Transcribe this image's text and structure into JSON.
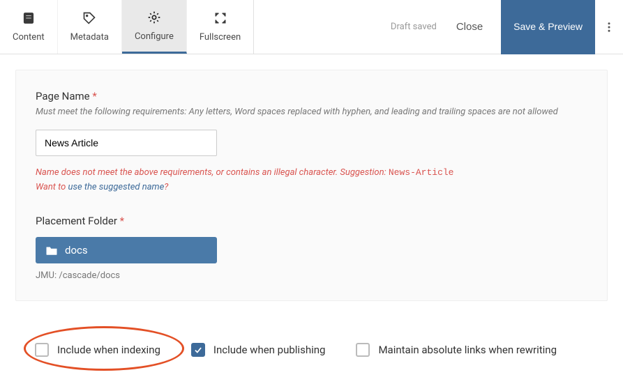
{
  "toolbar": {
    "tabs": [
      {
        "id": "content",
        "label": "Content"
      },
      {
        "id": "metadata",
        "label": "Metadata"
      },
      {
        "id": "configure",
        "label": "Configure"
      },
      {
        "id": "fullscreen",
        "label": "Fullscreen"
      }
    ],
    "draft_saved": "Draft saved",
    "close": "Close",
    "save_preview": "Save & Preview"
  },
  "page_name": {
    "label": "Page Name",
    "help": "Must meet the following requirements: Any letters, Word spaces replaced with hyphen, and leading and trailing spaces are not allowed",
    "value": "News Article",
    "error_prefix": "Name does not meet the above requirements, or contains an illegal character. Suggestion: ",
    "suggestion": "News-Article",
    "error_line2_prefix": "Want to ",
    "error_link": "use the suggested name",
    "error_line2_suffix": "?"
  },
  "placement": {
    "label": "Placement Folder",
    "folder": "docs",
    "path": "JMU: /cascade/docs"
  },
  "checkboxes": {
    "indexing": "Include when indexing",
    "publishing": "Include when publishing",
    "absolute": "Maintain absolute links when rewriting"
  }
}
